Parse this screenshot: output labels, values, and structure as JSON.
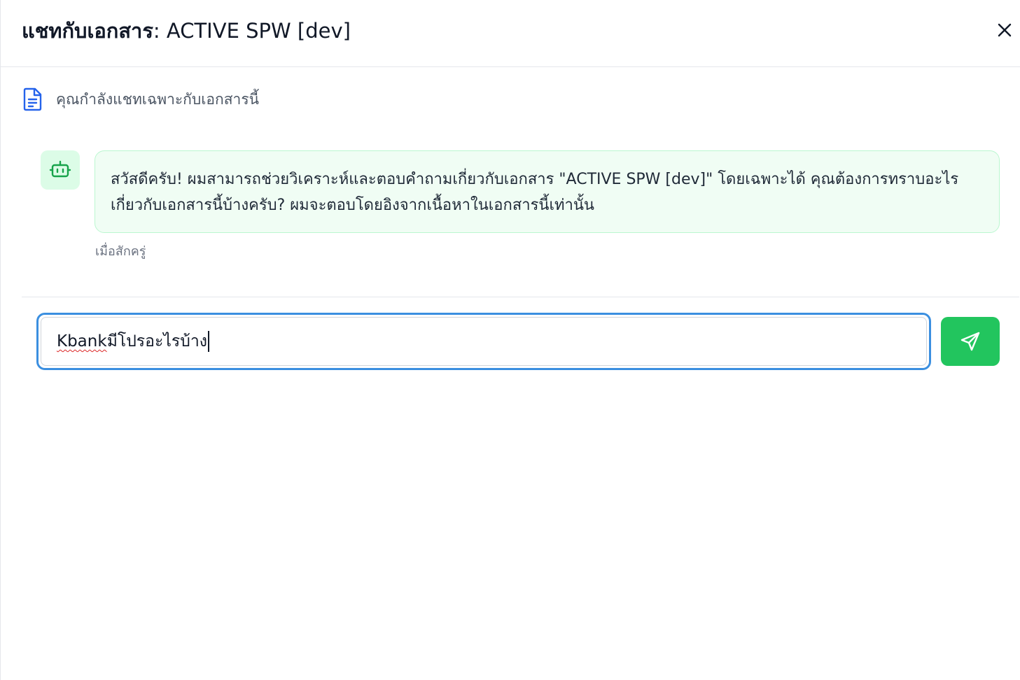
{
  "header": {
    "title_prefix": "แชทกับเอกสาร",
    "title_doc": ": ACTIVE SPW [dev]",
    "close_icon": "close-icon"
  },
  "notice": {
    "icon": "document-icon",
    "text": "คุณกำลังแชทเฉพาะกับเอกสารนี้"
  },
  "messages": [
    {
      "role": "assistant",
      "avatar_icon": "bot-icon",
      "text": "สวัสดีครับ! ผมสามารถช่วยวิเคราะห์และตอบคำถามเกี่ยวกับเอกสาร \"ACTIVE SPW [dev]\" โดยเฉพาะได้ คุณต้องการทราบอะไรเกี่ยวกับเอกสารนี้บ้างครับ? ผมจะตอบโดยอิงจากเนื้อหาในเอกสารนี้เท่านั้น",
      "timestamp": "เมื่อสักครู่"
    }
  ],
  "composer": {
    "value_word": "Kbank",
    "value_rest": " มีโปรอะไรบ้าง",
    "send_icon": "send-icon"
  },
  "colors": {
    "accent": "#22c55e",
    "focus_ring": "#3b8fe0",
    "bubble_bg": "#f0fdf4",
    "avatar_bg": "#dcfce7",
    "icon_blue": "#2563eb"
  }
}
